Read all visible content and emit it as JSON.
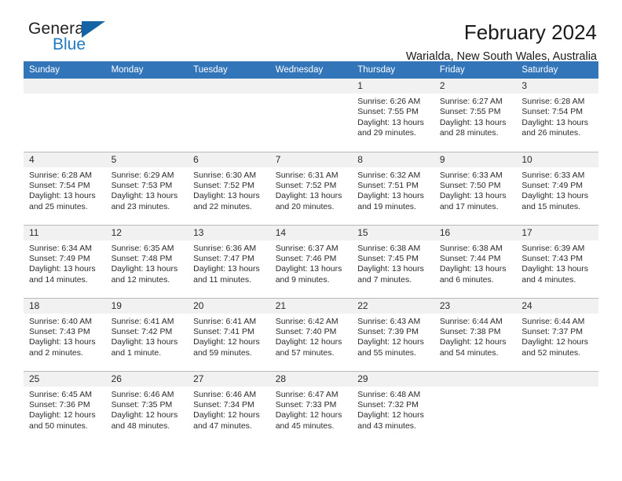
{
  "brand": {
    "name_top": "General",
    "name_bottom": "Blue",
    "accent_color": "#1f7ac0",
    "triangle_color": "#1464a5"
  },
  "header": {
    "title": "February 2024",
    "location": "Warialda, New South Wales, Australia"
  },
  "calendar": {
    "header_background": "#3275b8",
    "daynum_background": "#f1f1f1",
    "weekdays": [
      "Sunday",
      "Monday",
      "Tuesday",
      "Wednesday",
      "Thursday",
      "Friday",
      "Saturday"
    ],
    "labels": {
      "sunrise": "Sunrise:",
      "sunset": "Sunset:",
      "daylight": "Daylight:"
    },
    "weeks": [
      [
        {
          "day": ""
        },
        {
          "day": ""
        },
        {
          "day": ""
        },
        {
          "day": ""
        },
        {
          "day": "1",
          "sunrise": "Sunrise: 6:26 AM",
          "sunset": "Sunset: 7:55 PM",
          "daylight1": "Daylight: 13 hours",
          "daylight2": "and 29 minutes."
        },
        {
          "day": "2",
          "sunrise": "Sunrise: 6:27 AM",
          "sunset": "Sunset: 7:55 PM",
          "daylight1": "Daylight: 13 hours",
          "daylight2": "and 28 minutes."
        },
        {
          "day": "3",
          "sunrise": "Sunrise: 6:28 AM",
          "sunset": "Sunset: 7:54 PM",
          "daylight1": "Daylight: 13 hours",
          "daylight2": "and 26 minutes."
        }
      ],
      [
        {
          "day": "4",
          "sunrise": "Sunrise: 6:28 AM",
          "sunset": "Sunset: 7:54 PM",
          "daylight1": "Daylight: 13 hours",
          "daylight2": "and 25 minutes."
        },
        {
          "day": "5",
          "sunrise": "Sunrise: 6:29 AM",
          "sunset": "Sunset: 7:53 PM",
          "daylight1": "Daylight: 13 hours",
          "daylight2": "and 23 minutes."
        },
        {
          "day": "6",
          "sunrise": "Sunrise: 6:30 AM",
          "sunset": "Sunset: 7:52 PM",
          "daylight1": "Daylight: 13 hours",
          "daylight2": "and 22 minutes."
        },
        {
          "day": "7",
          "sunrise": "Sunrise: 6:31 AM",
          "sunset": "Sunset: 7:52 PM",
          "daylight1": "Daylight: 13 hours",
          "daylight2": "and 20 minutes."
        },
        {
          "day": "8",
          "sunrise": "Sunrise: 6:32 AM",
          "sunset": "Sunset: 7:51 PM",
          "daylight1": "Daylight: 13 hours",
          "daylight2": "and 19 minutes."
        },
        {
          "day": "9",
          "sunrise": "Sunrise: 6:33 AM",
          "sunset": "Sunset: 7:50 PM",
          "daylight1": "Daylight: 13 hours",
          "daylight2": "and 17 minutes."
        },
        {
          "day": "10",
          "sunrise": "Sunrise: 6:33 AM",
          "sunset": "Sunset: 7:49 PM",
          "daylight1": "Daylight: 13 hours",
          "daylight2": "and 15 minutes."
        }
      ],
      [
        {
          "day": "11",
          "sunrise": "Sunrise: 6:34 AM",
          "sunset": "Sunset: 7:49 PM",
          "daylight1": "Daylight: 13 hours",
          "daylight2": "and 14 minutes."
        },
        {
          "day": "12",
          "sunrise": "Sunrise: 6:35 AM",
          "sunset": "Sunset: 7:48 PM",
          "daylight1": "Daylight: 13 hours",
          "daylight2": "and 12 minutes."
        },
        {
          "day": "13",
          "sunrise": "Sunrise: 6:36 AM",
          "sunset": "Sunset: 7:47 PM",
          "daylight1": "Daylight: 13 hours",
          "daylight2": "and 11 minutes."
        },
        {
          "day": "14",
          "sunrise": "Sunrise: 6:37 AM",
          "sunset": "Sunset: 7:46 PM",
          "daylight1": "Daylight: 13 hours",
          "daylight2": "and 9 minutes."
        },
        {
          "day": "15",
          "sunrise": "Sunrise: 6:38 AM",
          "sunset": "Sunset: 7:45 PM",
          "daylight1": "Daylight: 13 hours",
          "daylight2": "and 7 minutes."
        },
        {
          "day": "16",
          "sunrise": "Sunrise: 6:38 AM",
          "sunset": "Sunset: 7:44 PM",
          "daylight1": "Daylight: 13 hours",
          "daylight2": "and 6 minutes."
        },
        {
          "day": "17",
          "sunrise": "Sunrise: 6:39 AM",
          "sunset": "Sunset: 7:43 PM",
          "daylight1": "Daylight: 13 hours",
          "daylight2": "and 4 minutes."
        }
      ],
      [
        {
          "day": "18",
          "sunrise": "Sunrise: 6:40 AM",
          "sunset": "Sunset: 7:43 PM",
          "daylight1": "Daylight: 13 hours",
          "daylight2": "and 2 minutes."
        },
        {
          "day": "19",
          "sunrise": "Sunrise: 6:41 AM",
          "sunset": "Sunset: 7:42 PM",
          "daylight1": "Daylight: 13 hours",
          "daylight2": "and 1 minute."
        },
        {
          "day": "20",
          "sunrise": "Sunrise: 6:41 AM",
          "sunset": "Sunset: 7:41 PM",
          "daylight1": "Daylight: 12 hours",
          "daylight2": "and 59 minutes."
        },
        {
          "day": "21",
          "sunrise": "Sunrise: 6:42 AM",
          "sunset": "Sunset: 7:40 PM",
          "daylight1": "Daylight: 12 hours",
          "daylight2": "and 57 minutes."
        },
        {
          "day": "22",
          "sunrise": "Sunrise: 6:43 AM",
          "sunset": "Sunset: 7:39 PM",
          "daylight1": "Daylight: 12 hours",
          "daylight2": "and 55 minutes."
        },
        {
          "day": "23",
          "sunrise": "Sunrise: 6:44 AM",
          "sunset": "Sunset: 7:38 PM",
          "daylight1": "Daylight: 12 hours",
          "daylight2": "and 54 minutes."
        },
        {
          "day": "24",
          "sunrise": "Sunrise: 6:44 AM",
          "sunset": "Sunset: 7:37 PM",
          "daylight1": "Daylight: 12 hours",
          "daylight2": "and 52 minutes."
        }
      ],
      [
        {
          "day": "25",
          "sunrise": "Sunrise: 6:45 AM",
          "sunset": "Sunset: 7:36 PM",
          "daylight1": "Daylight: 12 hours",
          "daylight2": "and 50 minutes."
        },
        {
          "day": "26",
          "sunrise": "Sunrise: 6:46 AM",
          "sunset": "Sunset: 7:35 PM",
          "daylight1": "Daylight: 12 hours",
          "daylight2": "and 48 minutes."
        },
        {
          "day": "27",
          "sunrise": "Sunrise: 6:46 AM",
          "sunset": "Sunset: 7:34 PM",
          "daylight1": "Daylight: 12 hours",
          "daylight2": "and 47 minutes."
        },
        {
          "day": "28",
          "sunrise": "Sunrise: 6:47 AM",
          "sunset": "Sunset: 7:33 PM",
          "daylight1": "Daylight: 12 hours",
          "daylight2": "and 45 minutes."
        },
        {
          "day": "29",
          "sunrise": "Sunrise: 6:48 AM",
          "sunset": "Sunset: 7:32 PM",
          "daylight1": "Daylight: 12 hours",
          "daylight2": "and 43 minutes."
        },
        {
          "day": ""
        },
        {
          "day": ""
        }
      ]
    ]
  }
}
